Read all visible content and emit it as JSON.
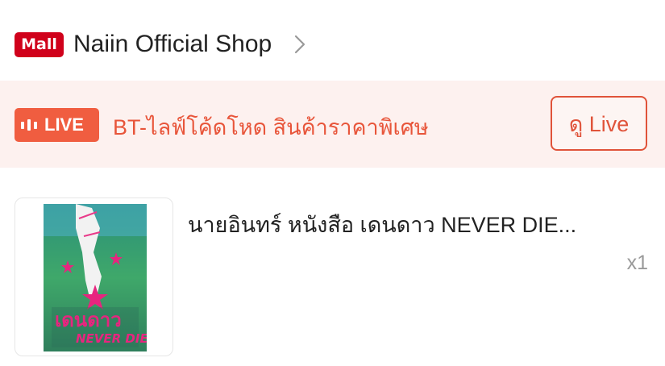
{
  "shop": {
    "badge": "Mall",
    "name": "Naiin Official Shop",
    "chevron_icon": "chevron-right-icon"
  },
  "live": {
    "badge_label": "LIVE",
    "badge_icon": "live-bars-icon",
    "text": "BT-ไลฟ์โค้ดโหด สินค้าราคาพิเศษ",
    "button_label": "ดู Live"
  },
  "product": {
    "title": "นายอินทร์ หนังสือ เดนดาว NEVER DIE...",
    "quantity": "x1",
    "cover_title_art": "เดนดาว NEVER DIE"
  },
  "colors": {
    "mall_red": "#d0011b",
    "live_orange": "#f05d40",
    "live_text": "#e8553a",
    "banner_bg": "#fdf1ef"
  }
}
